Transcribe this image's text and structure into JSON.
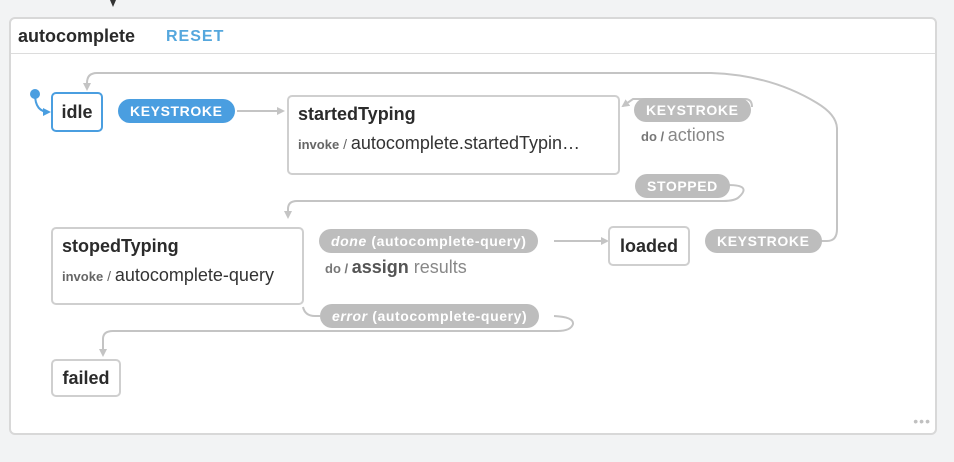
{
  "machine": {
    "title": "autocomplete",
    "reset_label": "RESET"
  },
  "states": {
    "idle": {
      "name": "idle"
    },
    "startedTyping": {
      "name": "startedTyping",
      "action_kind": "invoke",
      "action_value": "autocomplete.startedTypin…"
    },
    "stopedTyping": {
      "name": "stopedTyping",
      "action_kind": "invoke",
      "action_value": "autocomplete-query"
    },
    "loaded": {
      "name": "loaded"
    },
    "failed": {
      "name": "failed"
    }
  },
  "events": {
    "idle_keystroke": "KEYSTROKE",
    "started_keystroke": "KEYSTROKE",
    "started_keystroke_do": "do",
    "started_keystroke_action": "actions",
    "stopped": "STOPPED",
    "done_prefix": "done",
    "done_source": "(autocomplete-query)",
    "done_do": "do",
    "done_assign": "assign",
    "done_results": "results",
    "error_prefix": "error",
    "error_source": "(autocomplete-query)",
    "loaded_keystroke": "KEYSTROKE"
  },
  "footer": {
    "more_label": "•••"
  },
  "colors": {
    "active": "#4a9ee0",
    "inactive": "#bdbdbd",
    "reset": "#55a7dd"
  }
}
